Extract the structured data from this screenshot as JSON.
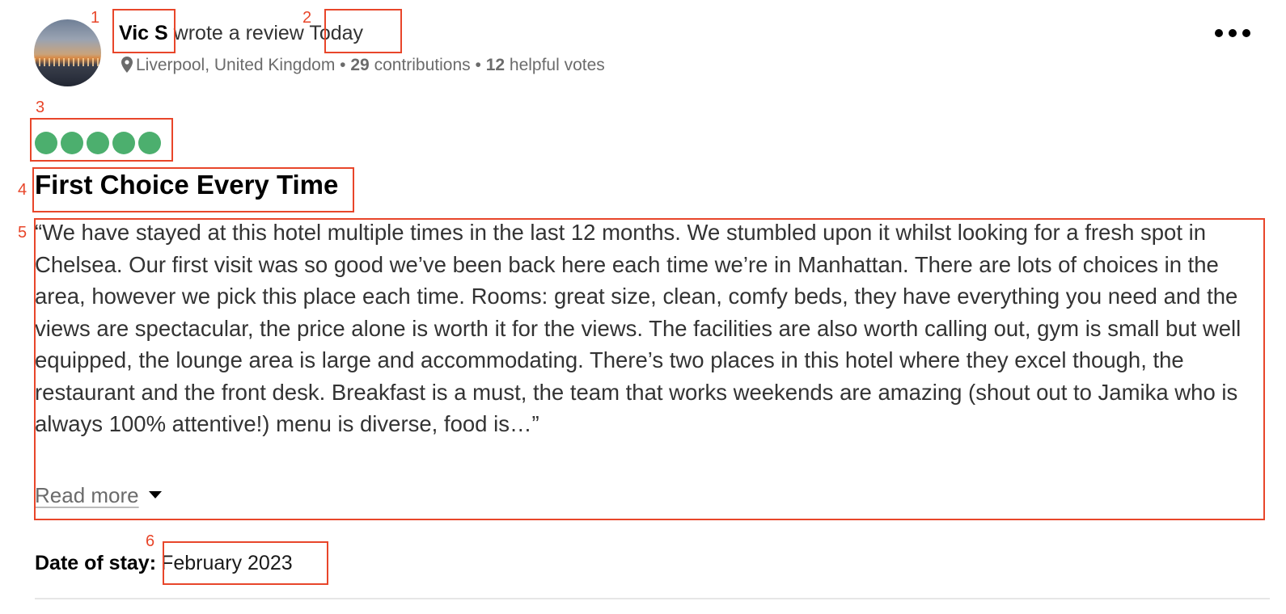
{
  "review": {
    "author": "Vic S",
    "action_text": "wrote a review",
    "when": "Today",
    "location": "Liverpool, United Kingdom",
    "contributions_count": "29",
    "contributions_label": "contributions",
    "helpful_count": "12",
    "helpful_label": "helpful votes",
    "separator": "•",
    "rating": 5,
    "rating_max": 5,
    "title": "First Choice Every Time",
    "body": "“We have stayed at this hotel multiple times in the last 12 months. We stumbled upon it whilst looking for a fresh spot in Chelsea. Our first visit was so good we’ve been back here each time we’re in Manhattan. There are lots of choices in the area, however we pick this place each time. Rooms: great size, clean, comfy beds, they have everything you need and the views are spectacular, the price alone is worth it for the views. The facilities are also worth calling out, gym is small but well equipped, the lounge area is large and accommodating. There’s two places in this hotel where they excel though, the restaurant and the front desk. Breakfast is a must, the team that works weekends are amazing (shout out to Jamika who is always 100% attentive!) menu is diverse, food is…”",
    "read_more": "Read more",
    "date_of_stay_label": "Date of stay:",
    "date_of_stay": "February 2023"
  },
  "annotations": [
    "1",
    "2",
    "3",
    "4",
    "5",
    "6"
  ],
  "icons": {
    "location": "map-pin-icon",
    "menu": "more-options-icon",
    "expand": "chevron-down-icon"
  },
  "colors": {
    "rating_bubble": "#4caf6e",
    "annotation": "#e8462a",
    "muted_text": "#6b6b6b"
  }
}
